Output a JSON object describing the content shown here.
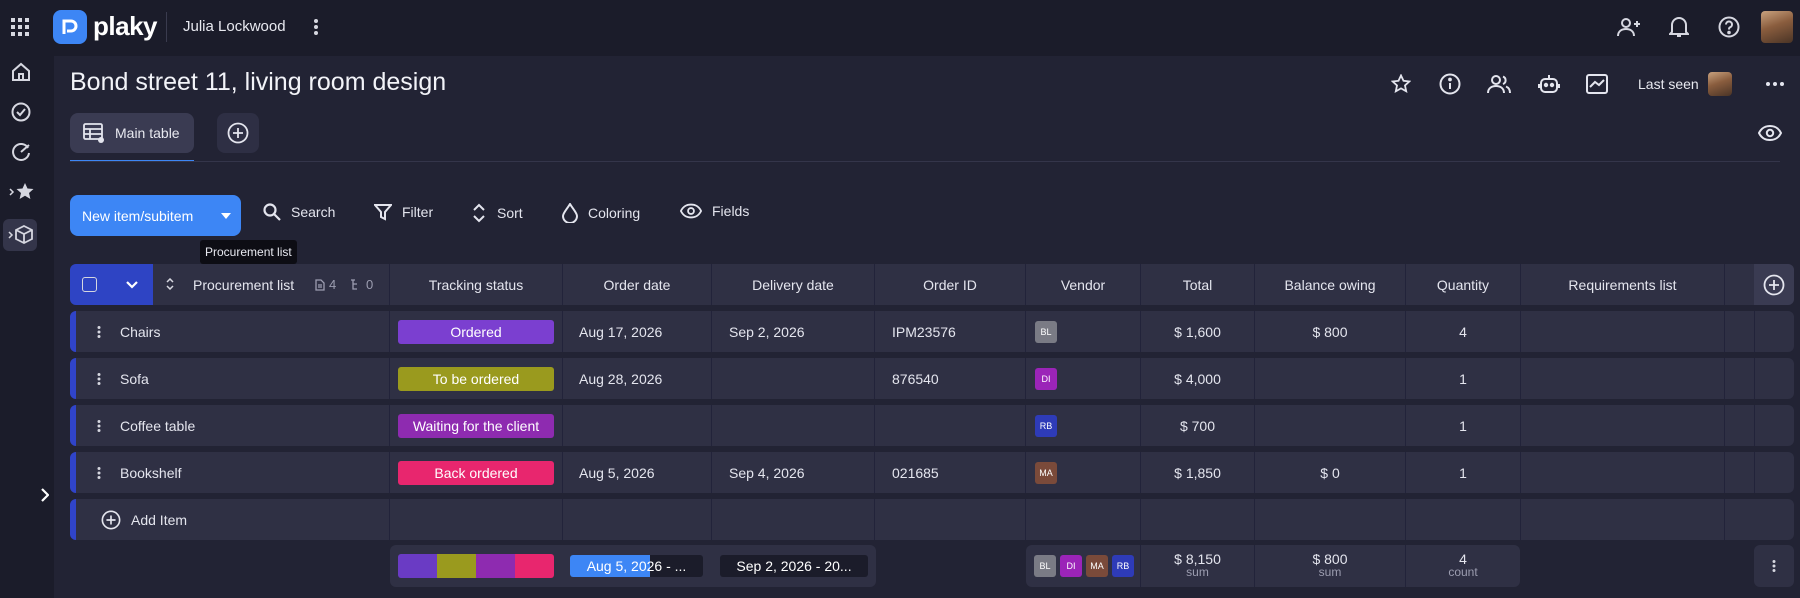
{
  "app": {
    "brand": "plaky",
    "workspace": "Julia Lockwood"
  },
  "board": {
    "title": "Bond street 11, living room design",
    "last_seen_label": "Last seen"
  },
  "tabs": [
    {
      "label": "Main table",
      "active": true
    }
  ],
  "toolbar": {
    "new_item_label": "New item/subitem",
    "search_label": "Search",
    "filter_label": "Filter",
    "sort_label": "Sort",
    "coloring_label": "Coloring",
    "fields_label": "Fields"
  },
  "tooltip": "Procurement list",
  "group": {
    "name": "Procurement list",
    "item_count": "4",
    "subitem_count": "0"
  },
  "columns": [
    "Tracking status",
    "Order date",
    "Delivery date",
    "Order ID",
    "Vendor",
    "Total",
    "Balance owing",
    "Quantity",
    "Requirements list"
  ],
  "rows": [
    {
      "name": "Chairs",
      "status": "Ordered",
      "status_color": "#7b3fd0",
      "order_date": "Aug 17, 2026",
      "delivery_date": "Sep 2, 2026",
      "order_id": "IPM23576",
      "vendor": "BL",
      "vendor_color": "#7a7b85",
      "total": "$ 1,600",
      "balance": "$ 800",
      "quantity": "4"
    },
    {
      "name": "Sofa",
      "status": "To be ordered",
      "status_color": "#9a9a1e",
      "order_date": "Aug 28, 2026",
      "delivery_date": "",
      "order_id": "876540",
      "vendor": "DI",
      "vendor_color": "#9b24b8",
      "total": "$ 4,000",
      "balance": "",
      "quantity": "1"
    },
    {
      "name": "Coffee table",
      "status": "Waiting for the client",
      "status_color": "#8e2bb0",
      "order_date": "",
      "delivery_date": "",
      "order_id": "",
      "vendor": "RB",
      "vendor_color": "#2e3bb8",
      "total": "$ 700",
      "balance": "",
      "quantity": "1"
    },
    {
      "name": "Bookshelf",
      "status": "Back ordered",
      "status_color": "#e8266e",
      "order_date": "Aug 5, 2026",
      "delivery_date": "Sep 4, 2026",
      "order_id": "021685",
      "vendor": "MA",
      "vendor_color": "#7a4a3a",
      "total": "$ 1,850",
      "balance": "$ 0",
      "quantity": "1"
    }
  ],
  "add_item_label": "Add Item",
  "summary": {
    "status_colors": [
      "#6a3bc4",
      "#9a9a1e",
      "#8e2bb0",
      "#e8266e"
    ],
    "order_date_range": "Aug 5, 2026 - ...",
    "order_date_progress": 0.6,
    "delivery_date_range": "Sep 2, 2026 - 20...",
    "vendors": [
      {
        "code": "BL",
        "color": "#7a7b85"
      },
      {
        "code": "DI",
        "color": "#9b24b8"
      },
      {
        "code": "MA",
        "color": "#7a4a3a"
      },
      {
        "code": "RB",
        "color": "#2e3bb8"
      }
    ],
    "total_value": "$ 8,150",
    "total_label": "sum",
    "balance_value": "$ 800",
    "balance_label": "sum",
    "quantity_value": "4",
    "quantity_label": "count"
  }
}
